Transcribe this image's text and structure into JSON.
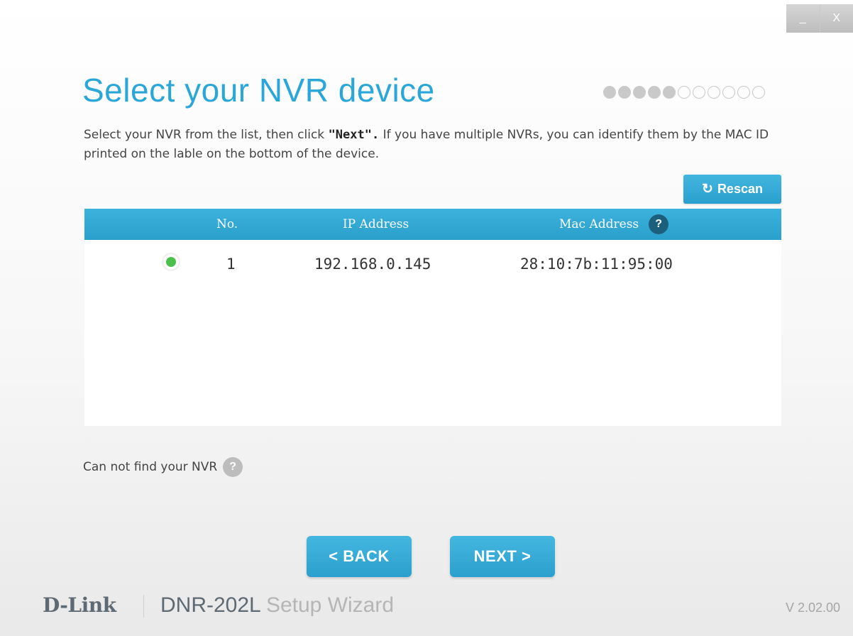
{
  "window": {
    "minimize_label": "_",
    "close_label": "X"
  },
  "page": {
    "title": "Select your NVR device",
    "steps": {
      "total": 11,
      "completed": 5
    }
  },
  "description": {
    "part1": "Select your NVR from the list, then click ",
    "bold": "\"Next\".",
    "part2": "  If you have multiple NVRs, you can identify them by the MAC ID printed on the lable on the bottom of the device."
  },
  "rescan": {
    "label": "Rescan",
    "icon": "refresh-icon"
  },
  "table": {
    "headers": {
      "no": "No.",
      "ip": "IP Address",
      "mac": "Mac Address"
    },
    "help_glyph": "?",
    "rows": [
      {
        "selected": true,
        "no": "1",
        "ip": "192.168.0.145",
        "mac": "28:10:7b:11:95:00"
      }
    ]
  },
  "cannot_find": {
    "label": "Can not find your NVR",
    "help_glyph": "?"
  },
  "buttons": {
    "back": "<  BACK",
    "next": "NEXT  >"
  },
  "footer": {
    "brand": "D-Link",
    "product": "DNR-202L",
    "product_suffix": " Setup Wizard",
    "version": "V 2.02.00"
  },
  "colors": {
    "accent": "#2aa7d8",
    "status_ok": "#4cc04c",
    "help_dark": "#1c5f7c"
  }
}
